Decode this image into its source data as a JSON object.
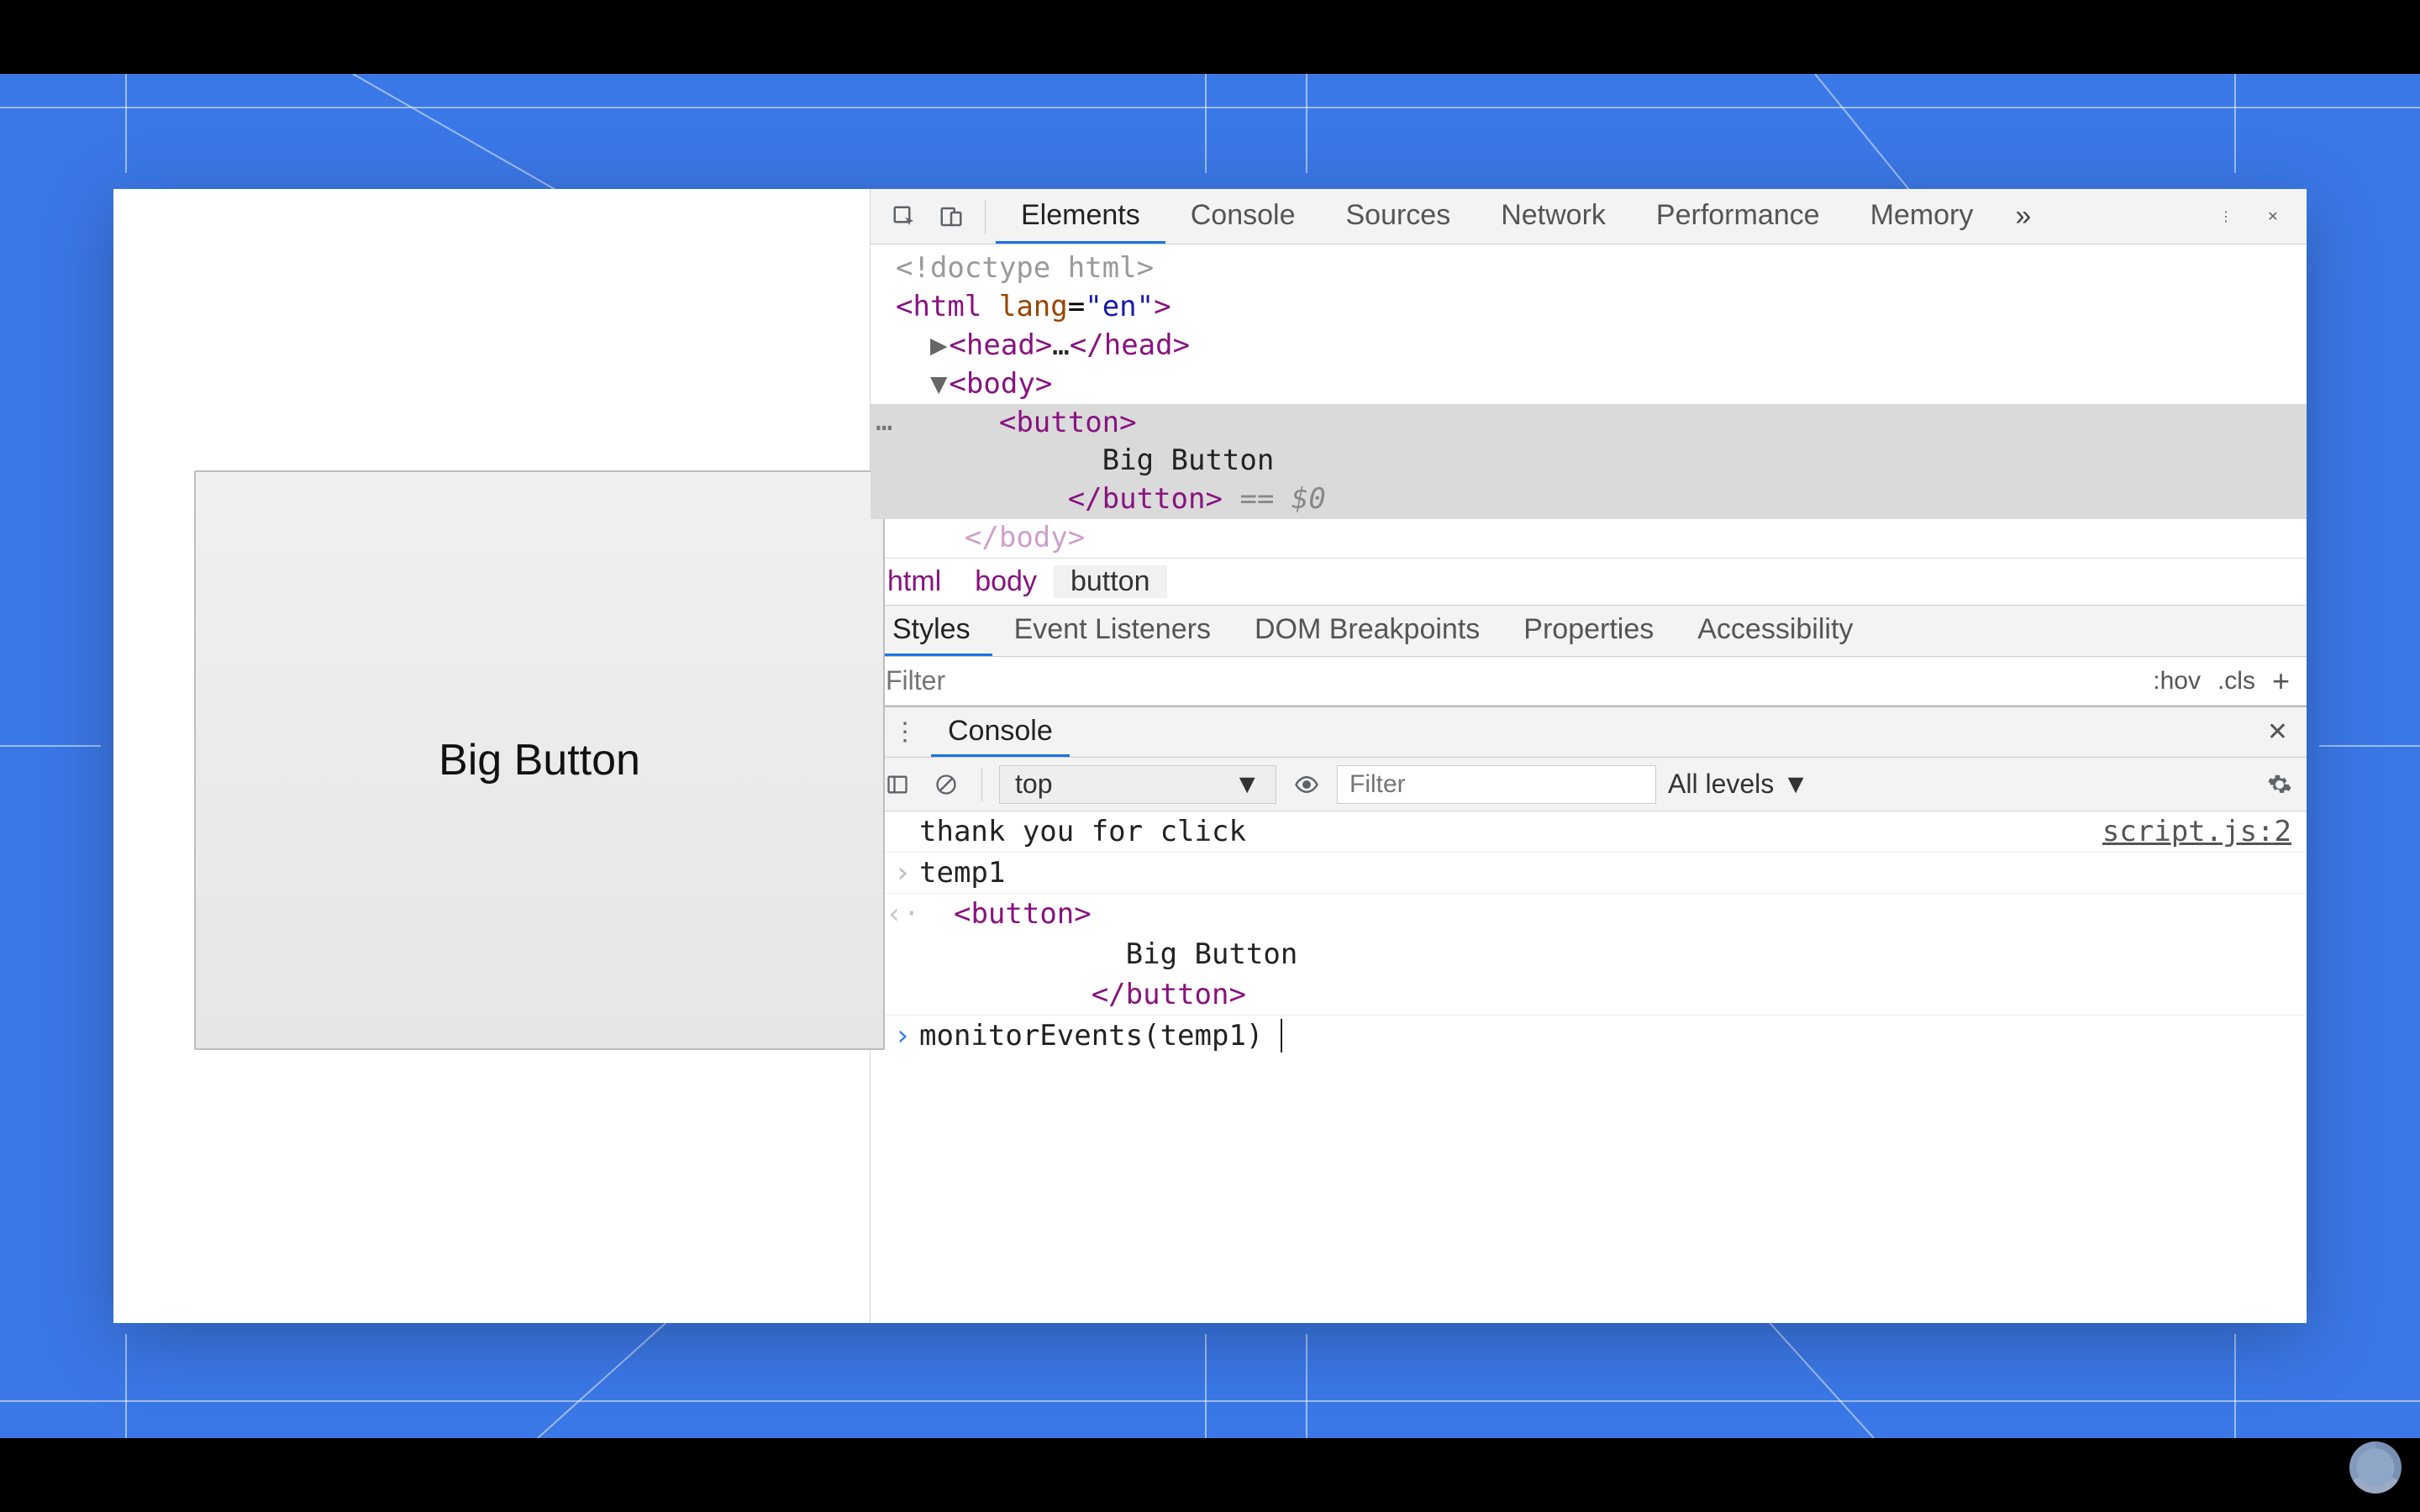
{
  "page": {
    "button_label": "Big Button"
  },
  "toolbar": {
    "tabs": [
      "Elements",
      "Console",
      "Sources",
      "Network",
      "Performance",
      "Memory"
    ],
    "active_tab": "Elements"
  },
  "dom": {
    "doctype": "<!doctype html>",
    "html_open": "<html lang=\"en\">",
    "head": "<head>…</head>",
    "body_open": "<body>",
    "button_open": "<button>",
    "button_text": "Big Button",
    "button_close": "</button>",
    "eq0": "== $0",
    "body_close": "</body>"
  },
  "breadcrumb": [
    "html",
    "body",
    "button"
  ],
  "styles_pane": {
    "tabs": [
      "Styles",
      "Event Listeners",
      "DOM Breakpoints",
      "Properties",
      "Accessibility"
    ],
    "active_tab": "Styles",
    "filter_placeholder": "Filter",
    "hov": ":hov",
    "cls": ".cls",
    "plus": "+"
  },
  "console_drawer": {
    "tab_label": "Console",
    "context": "top",
    "filter_placeholder": "Filter",
    "levels": "All levels",
    "log_message": "thank you for click",
    "log_source": "script.js:2",
    "input1": "temp1",
    "output_button_open": "<button>",
    "output_button_text": "Big Button",
    "output_button_close": "</button>",
    "input_current": "monitorEvents(temp1)"
  }
}
